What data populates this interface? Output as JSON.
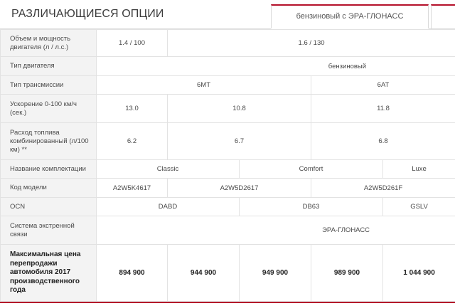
{
  "header": {
    "title": "РАЗЛИЧАЮЩИЕСЯ ОПЦИИ",
    "tab_label": "бензиновый с ЭРА-ГЛОНАСС"
  },
  "rows": {
    "engine": {
      "label": "Объем и мощность двигателя (л / л.с.)",
      "v1": "1.4 / 100",
      "v2": "1.6 / 130"
    },
    "type": {
      "label": "Тип двигателя",
      "v1": "бензиновый"
    },
    "transmission": {
      "label": "Тип трансмиссии",
      "v1": "6МТ",
      "v2": "6АТ"
    },
    "acceleration": {
      "label": "Ускорение 0-100 км/ч (сек.)",
      "v1": "13.0",
      "v2": "10.8",
      "v3": "11.8"
    },
    "fuel": {
      "label": "Расход топлива комбинированный (л/100 км) **",
      "v1": "6.2",
      "v2": "6.7",
      "v3": "6.8"
    },
    "trim": {
      "label": "Название комплектации",
      "v1": "Classic",
      "v2": "Comfort",
      "v3": "Luxe"
    },
    "model_code": {
      "label": "Код модели",
      "v1": "A2W5K4617",
      "v2": "A2W5D2617",
      "v3": "A2W5D261F"
    },
    "ocn": {
      "label": "OCN",
      "v1": "DABD",
      "v2": "DB63",
      "v3": "GSLV"
    },
    "emergency": {
      "label": "Система экстренной связи",
      "v1": "ЭРА-ГЛОНАСС"
    },
    "price": {
      "label": "Максимальная цена перепродажи автомобиля 2017 производственного года",
      "v1": "894 900",
      "v2": "944 900",
      "v3": "949 900",
      "v4": "989 900",
      "v5": "1 044 900"
    }
  },
  "colors": {
    "accent": "#b5112b",
    "label_bg": "#f3f3f3",
    "border": "#e2e2e2"
  }
}
